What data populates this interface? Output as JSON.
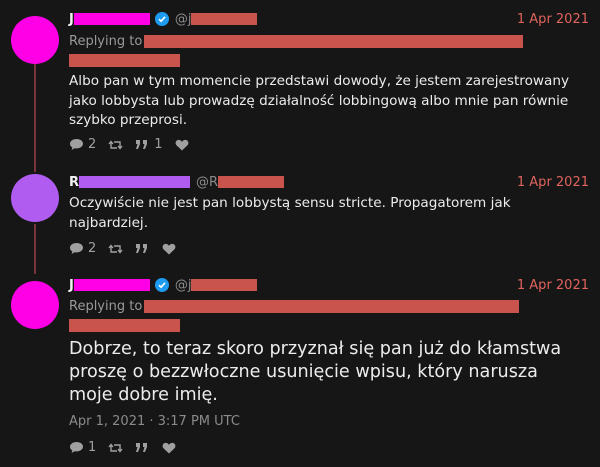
{
  "colors": {
    "background": "#161616",
    "thread_line": "#7a3338",
    "redaction": "#c9534d",
    "redaction_name_1": "#ff00e6",
    "redaction_name_2": "#b05cf0",
    "avatar_1": "#ff00e6",
    "avatar_2": "#b05cf0",
    "date": "#e0645e"
  },
  "tweets": [
    {
      "name_initial": "J",
      "handle_prefix": "@j",
      "verified": true,
      "date": "1 Apr 2021",
      "replying_label": "Replying to",
      "body": "Albo pan w tym momencie przedstawi dowody, że jestem zarejestrowany jako lobbysta lub prowadzę działalność lobbingową albo mnie pan równie szybko przeprosi.",
      "reply_count": "2",
      "retweet_count": "",
      "quote_count": "1",
      "icons": [
        "comment-icon",
        "retweet-icon",
        "quote-icon",
        "heart-icon"
      ]
    },
    {
      "name_initial": "R",
      "handle_prefix": "@R",
      "verified": false,
      "date": "1 Apr 2021",
      "body": "Oczywiście nie jest pan lobbystą sensu stricte. Propagatorem jak najbardziej.",
      "reply_count": "2",
      "retweet_count": "",
      "quote_count": ""
    },
    {
      "name_initial": "J",
      "handle_prefix": "@j",
      "verified": true,
      "date": "1 Apr 2021",
      "replying_label": "Replying to",
      "body": "Dobrze, to teraz skoro przyznał się pan już do kłamstwa proszę o bezzwłoczne usunięcie wpisu, który narusza moje dobre imię.",
      "timestamp": "Apr 1, 2021 · 3:17 PM UTC",
      "reply_count": "1",
      "retweet_count": "",
      "quote_count": ""
    }
  ]
}
